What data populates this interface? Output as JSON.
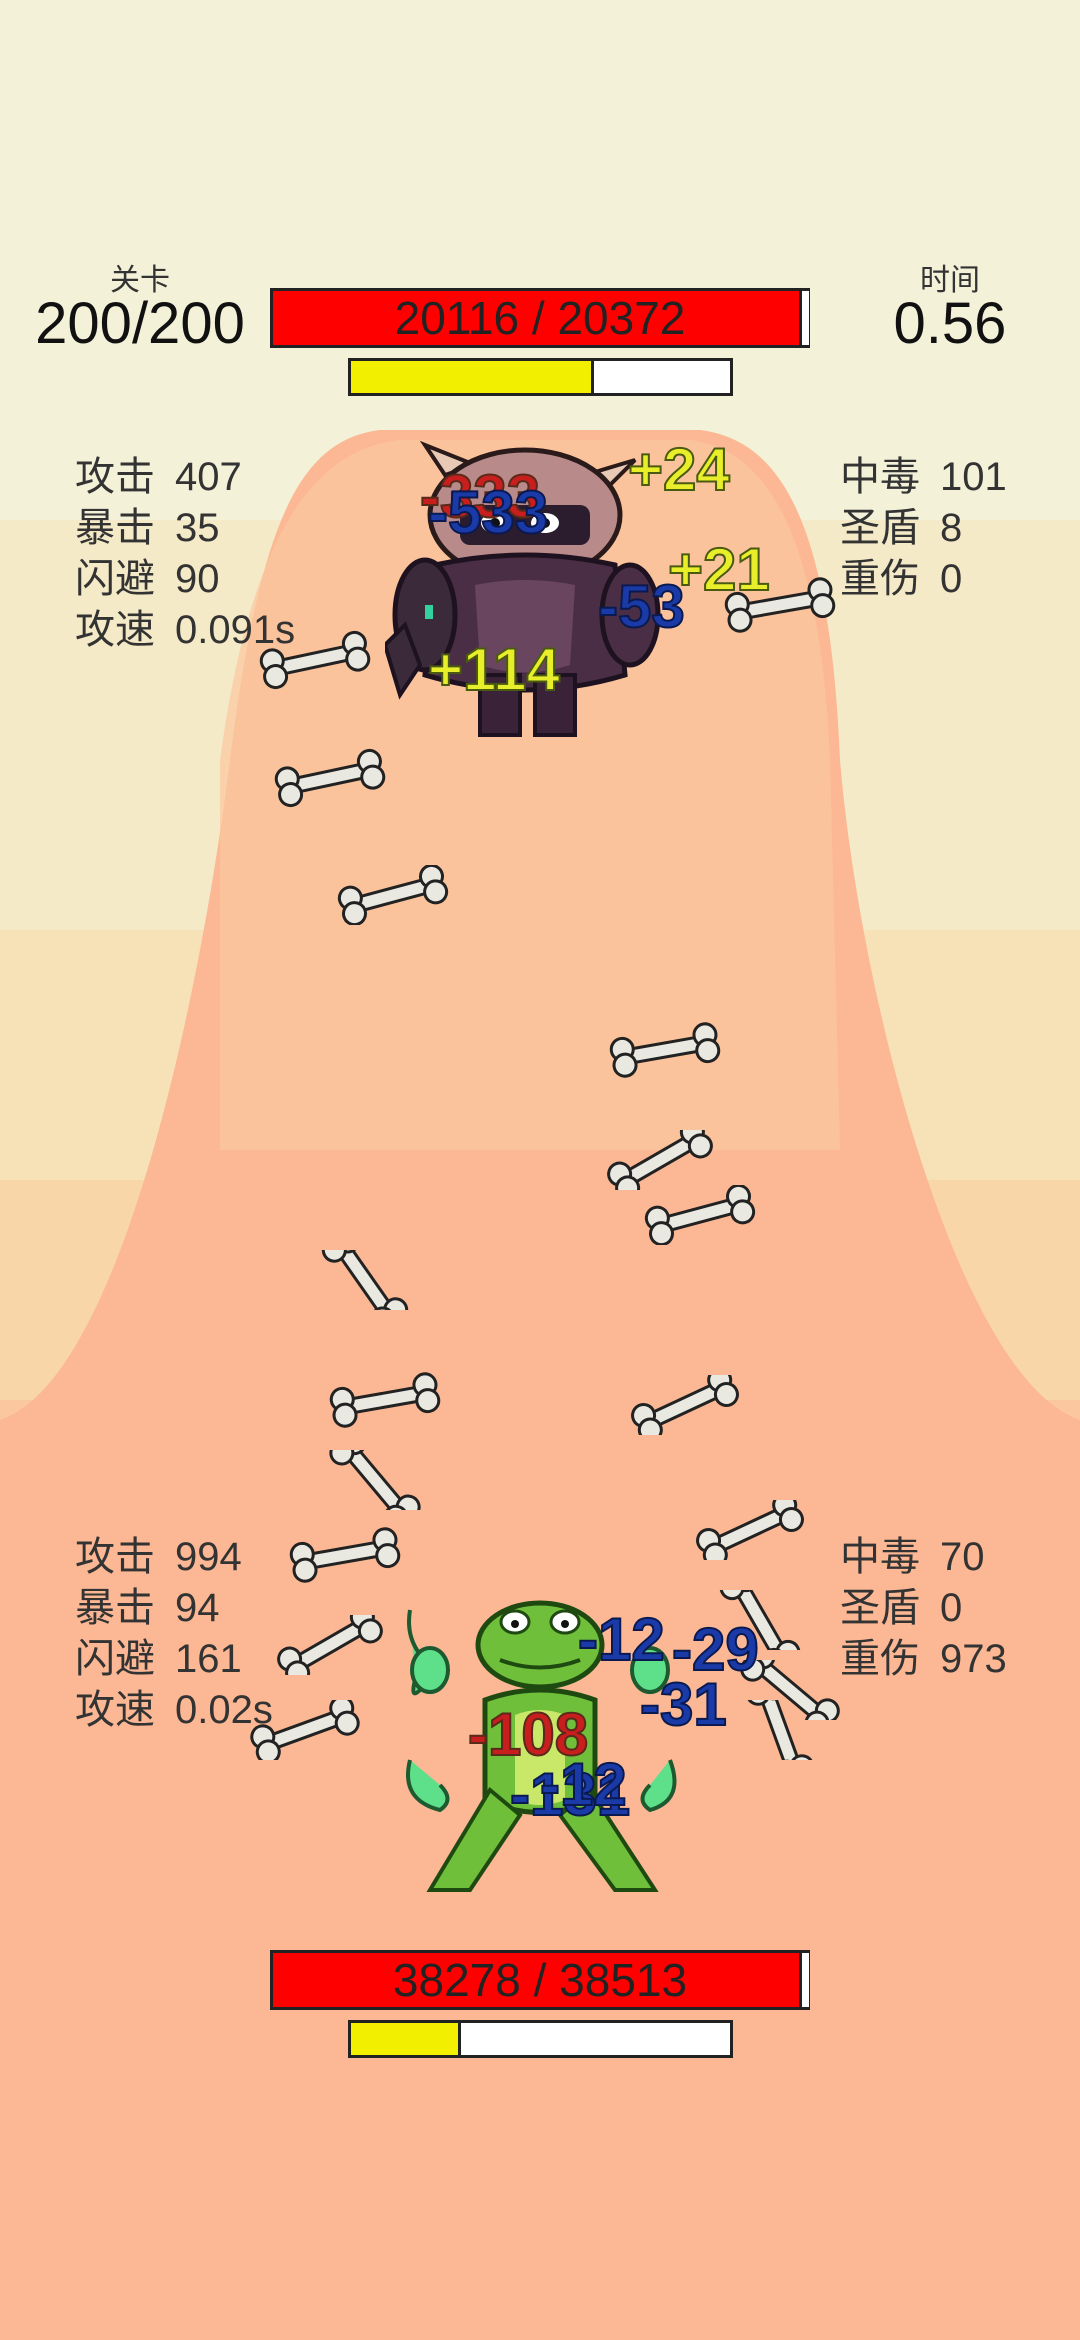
{
  "level": {
    "label": "关卡",
    "value": "200/200"
  },
  "timer": {
    "label": "时间",
    "value": "0.56"
  },
  "enemy": {
    "hp_text": "20116 / 20372",
    "hp_fraction": 0.987,
    "energy_fraction": 0.64,
    "stats_left": [
      {
        "label": "攻击",
        "value": "407"
      },
      {
        "label": "暴击",
        "value": "35"
      },
      {
        "label": "闪避",
        "value": "90"
      },
      {
        "label": "攻速",
        "value": "0.091s"
      }
    ],
    "stats_right": [
      {
        "label": "中毒",
        "value": "101"
      },
      {
        "label": "圣盾",
        "value": "8"
      },
      {
        "label": "重伤",
        "value": "0"
      }
    ],
    "damage_texts": [
      "-333",
      "-533",
      "+24",
      "+21",
      "-53",
      "+114"
    ]
  },
  "player": {
    "hp_text": "38278 / 38513",
    "hp_fraction": 0.994,
    "energy_fraction": 0.29,
    "stats_left": [
      {
        "label": "攻击",
        "value": "994"
      },
      {
        "label": "暴击",
        "value": "94"
      },
      {
        "label": "闪避",
        "value": "161"
      },
      {
        "label": "攻速",
        "value": "0.02s"
      }
    ],
    "stats_right": [
      {
        "label": "中毒",
        "value": "70"
      },
      {
        "label": "圣盾",
        "value": "0"
      },
      {
        "label": "重伤",
        "value": "973"
      }
    ],
    "damage_texts": [
      "-12",
      "-29",
      "-31",
      "-108",
      "-131",
      "-12"
    ]
  },
  "colors": {
    "hp": "#ff0000",
    "energy": "#f2ef00",
    "bone": "#e9e9e2"
  }
}
